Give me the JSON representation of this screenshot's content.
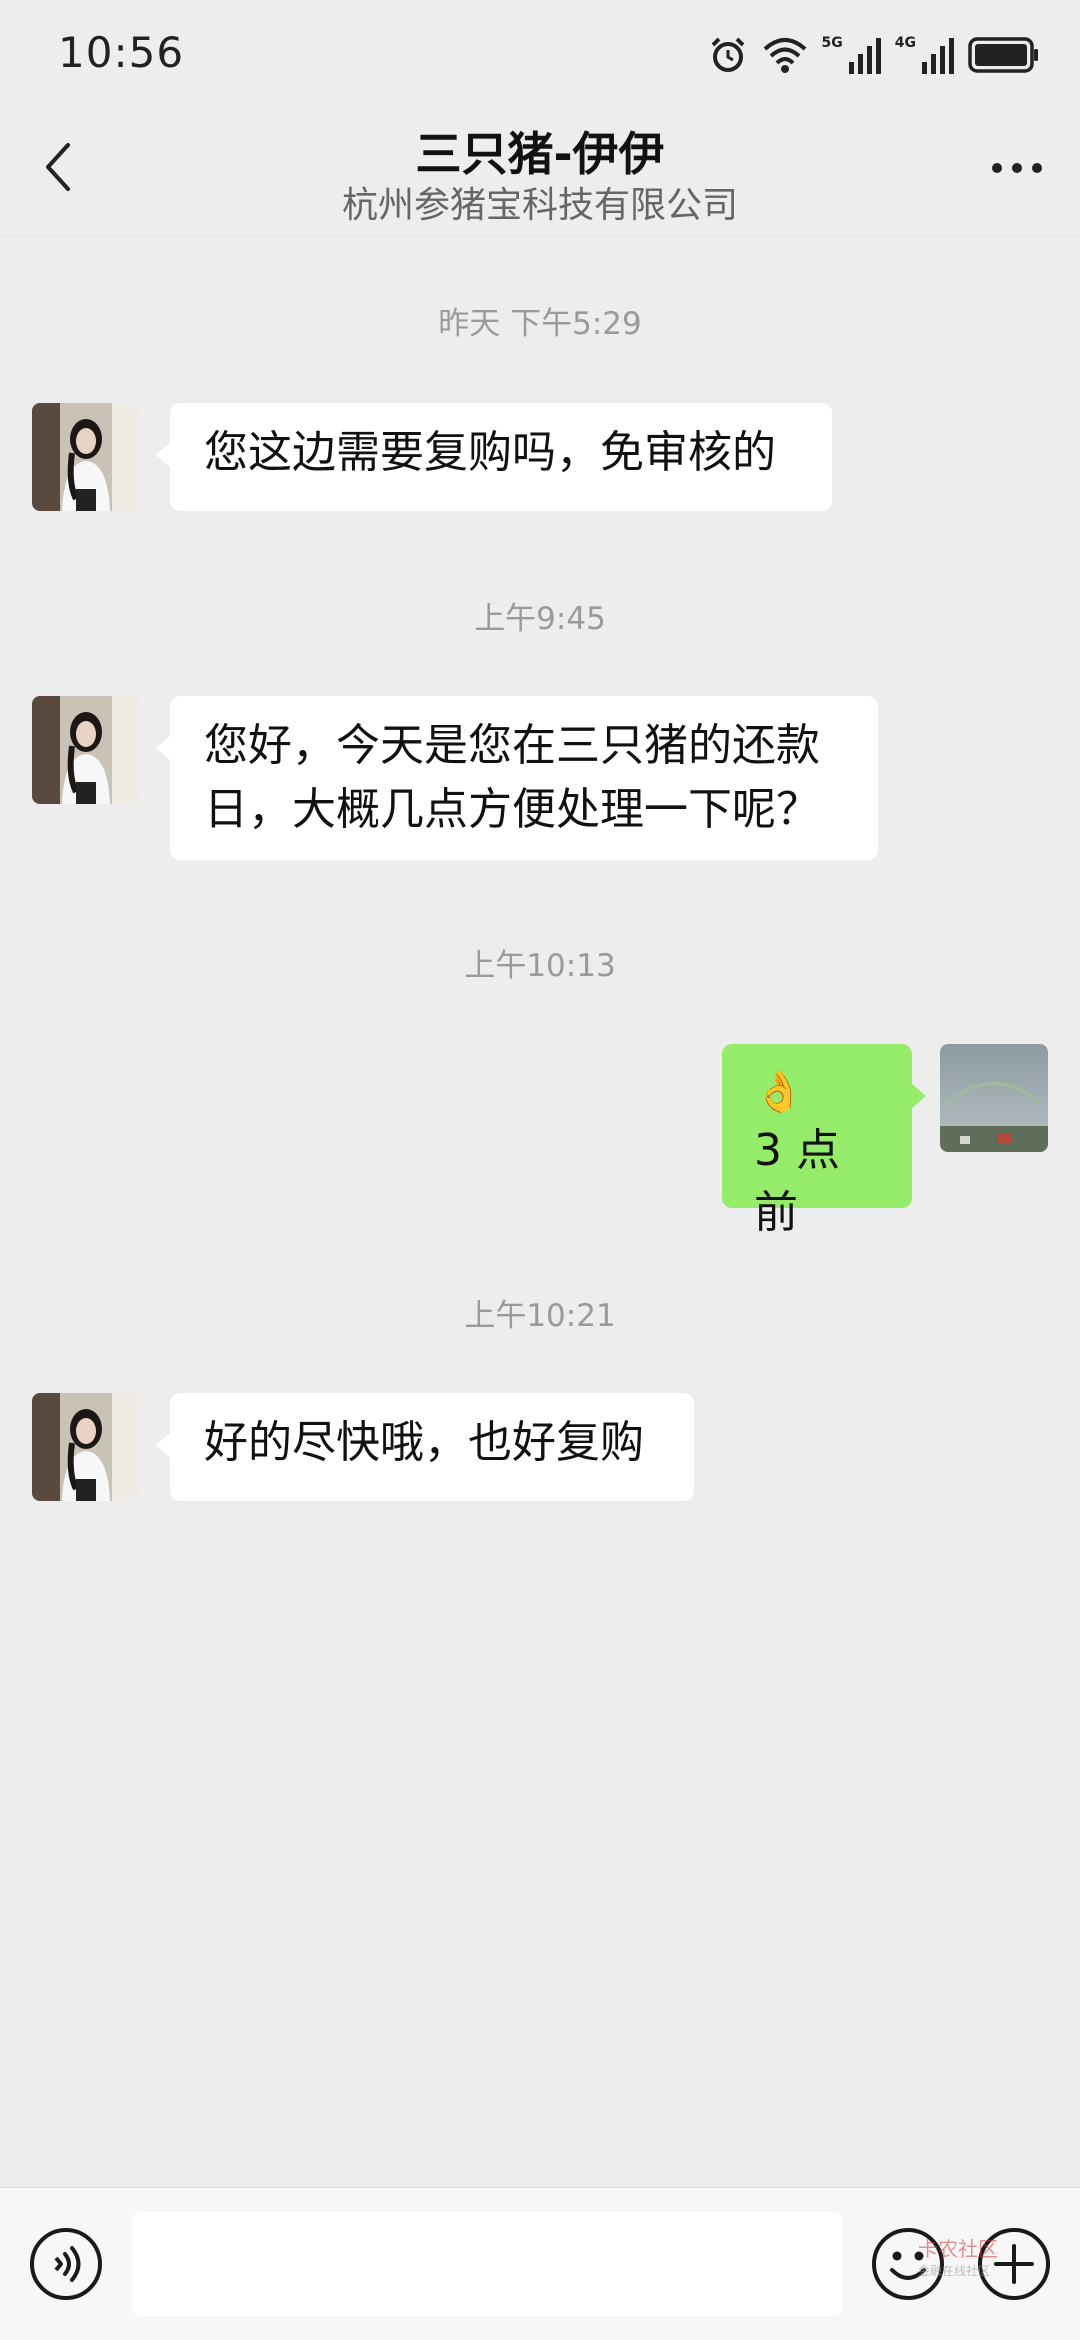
{
  "status_bar": {
    "time": "10:56",
    "net_5g": "5G",
    "net_4g": "4G",
    "icons": [
      "alarm-icon",
      "wifi-icon",
      "signal-5g-icon",
      "signal-4g-icon",
      "battery-icon"
    ]
  },
  "header": {
    "title": "三只猪-伊伊",
    "subtitle": "杭州参猪宝科技有限公司",
    "back_icon": "chevron-left-icon",
    "more_icon": "more-dots-icon"
  },
  "messages": [
    {
      "timestamp": "昨天 下午5:29",
      "side": "left",
      "lines": [
        "您这边需要复购吗，免审核的"
      ]
    },
    {
      "timestamp": "上午9:45",
      "side": "left",
      "lines": [
        "您好，今天是您在三只猪的还款",
        "日，大概几点方便处理一下呢？"
      ]
    },
    {
      "timestamp": "上午10:13",
      "side": "right",
      "emoji": "👌",
      "lines": [
        "3 点前"
      ]
    },
    {
      "timestamp": "上午10:21",
      "side": "left",
      "lines": [
        "好的尽快哦，也好复购"
      ]
    }
  ],
  "input_bar": {
    "message_value": "",
    "watermark": "卡农社区",
    "watermark_sub": "金融在线社区",
    "icons": [
      "voice-icon",
      "emoji-icon",
      "plus-icon"
    ]
  },
  "colors": {
    "background": "#ededed",
    "incoming_bubble": "#ffffff",
    "outgoing_bubble": "#95ec69"
  }
}
